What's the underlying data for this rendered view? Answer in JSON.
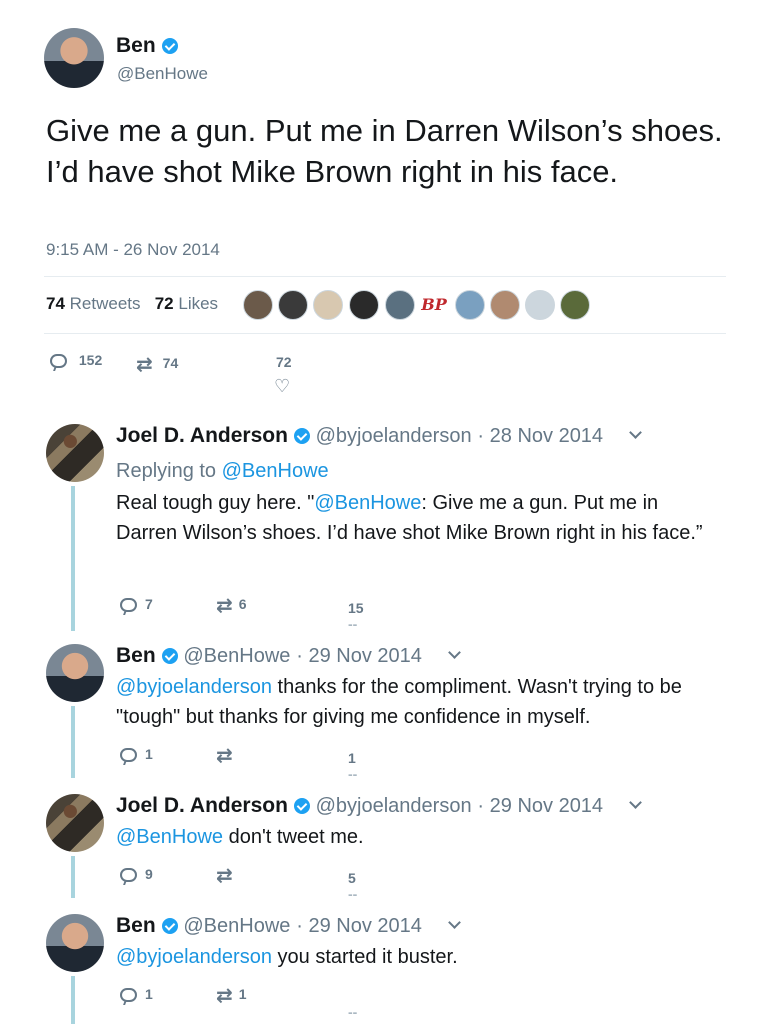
{
  "main_tweet": {
    "author_name": "Ben",
    "author_handle": "@BenHowe",
    "text": "Give me a gun. Put me in Darren Wilson’s shoes. I’d have shot Mike Brown right in his face.",
    "timestamp": "9:15 AM - 26 Nov 2014",
    "retweets_count": "74",
    "retweets_label": "Retweets",
    "likes_count": "72",
    "likes_label": "Likes",
    "liker_badge_text": "BP",
    "actions": {
      "replies": "152",
      "retweets": "74",
      "likes": "72"
    }
  },
  "replies": [
    {
      "author_name": "Joel D. Anderson",
      "author_handle": "@byjoelanderson",
      "date": "· 28 Nov 2014",
      "replying_to_label": "Replying to",
      "replying_to_handle": "@BenHowe",
      "text_before": "Real tough guy here. \"",
      "mention": "@BenHowe",
      "text_after": ": Give me a gun. Put me in Darren Wilson’s shoes. I’d have shot Mike Brown right in his face.”",
      "replies": "7",
      "retweets": "6",
      "likes": "15"
    },
    {
      "author_name": "Ben",
      "author_handle": "@BenHowe",
      "date": "· 29 Nov 2014",
      "mention": "@byjoelanderson",
      "text_after": " thanks for the compliment. Wasn't trying to be \"tough\" but thanks for giving me confidence in myself.",
      "replies": "1",
      "retweets": "",
      "likes": "1"
    },
    {
      "author_name": "Joel D. Anderson",
      "author_handle": "@byjoelanderson",
      "date": "· 29 Nov 2014",
      "mention": "@BenHowe",
      "text_after": " don't tweet me.",
      "replies": "9",
      "retweets": "",
      "likes": "5"
    },
    {
      "author_name": "Ben",
      "author_handle": "@BenHowe",
      "date": "· 29 Nov 2014",
      "mention": "@byjoelanderson",
      "text_after": " you started it buster.",
      "replies": "1",
      "retweets": "1",
      "likes": ""
    }
  ],
  "colors": {
    "link": "#1b95e0",
    "muted": "#657786",
    "thread_line": "#a8d4de",
    "verified": "#1da1f2"
  }
}
